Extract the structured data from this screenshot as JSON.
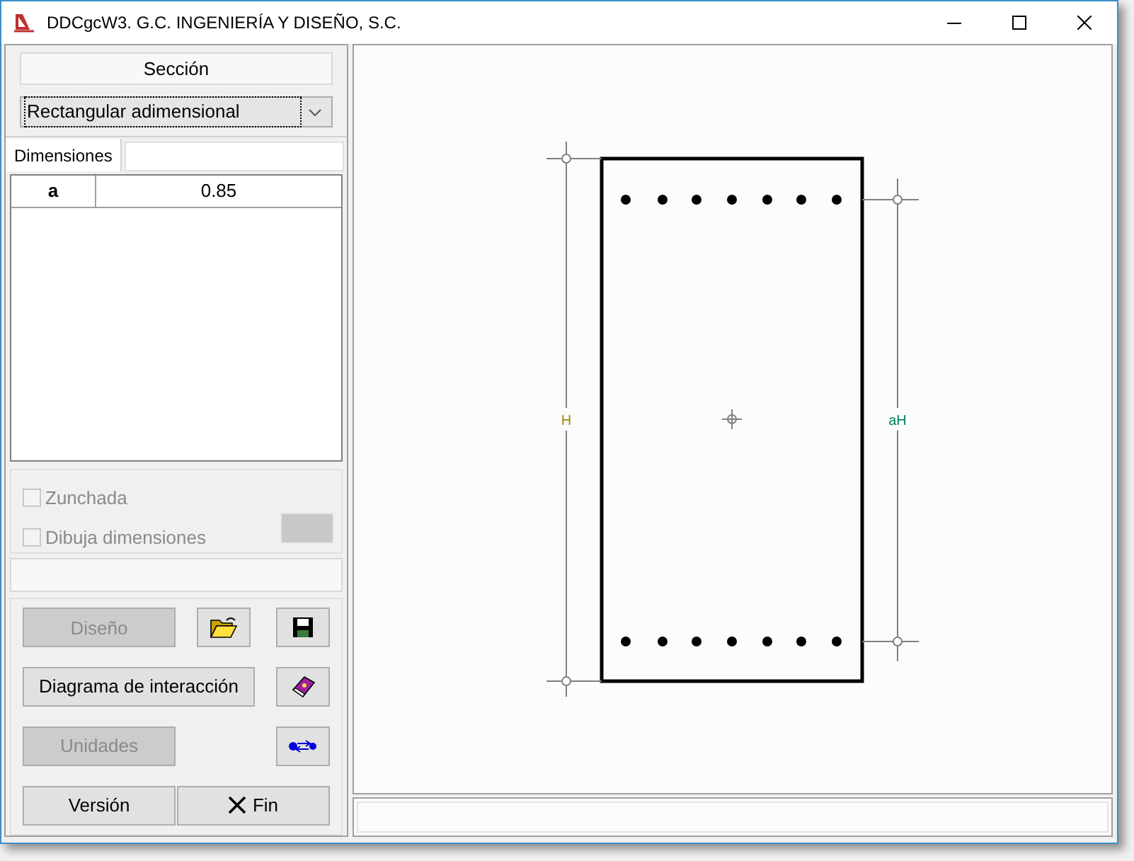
{
  "window": {
    "title": "DDCgcW3. G.C. INGENIERÍA Y DISEÑO, S.C."
  },
  "section_header": "Sección",
  "section_type": {
    "value": "Rectangular adimensional"
  },
  "tabs": [
    {
      "label": "Dimensiones",
      "selected": true
    }
  ],
  "dimensions_table": {
    "rows": [
      {
        "name": "a",
        "value": "0.85"
      }
    ]
  },
  "options": [
    {
      "label": "Zunchada",
      "checked": false,
      "disabled": true
    },
    {
      "label": "Dibuja dimensiones",
      "checked": false,
      "disabled": true
    }
  ],
  "buttons": [
    {
      "kind": "text",
      "label": "Diseño",
      "disabled": true
    },
    {
      "kind": "folder"
    },
    {
      "kind": "disk"
    },
    {
      "kind": "wide",
      "label": "Diagrama de interacción",
      "disabled": false
    },
    {
      "kind": "book"
    },
    {
      "kind": "text",
      "label": "Unidades",
      "disabled": true
    },
    {
      "kind": "arrows"
    },
    {
      "kind": "text",
      "label": "Versión",
      "disabled": false
    },
    {
      "kind": "close",
      "label": "Fin",
      "disabled": false
    }
  ],
  "drawing": {
    "height_label": "H",
    "bar_spacing_label": "aH"
  }
}
